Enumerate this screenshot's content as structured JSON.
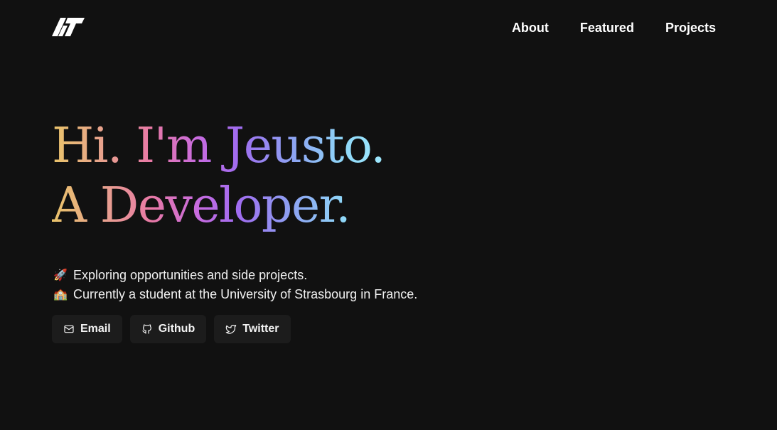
{
  "nav": {
    "logo_icon": "js-monogram-logo-icon",
    "links": [
      "About",
      "Featured",
      "Projects"
    ]
  },
  "hero": {
    "line1": "Hi. I'm Jeusto.",
    "line2": "A Developer.",
    "gradient_colors": [
      "#e9c46a",
      "#e879a6",
      "#a06cf0",
      "#8fd8f8"
    ]
  },
  "bio": {
    "items": [
      {
        "emoji": "🚀",
        "icon": "rocket-icon",
        "text": "Exploring opportunities and side projects."
      },
      {
        "emoji": "🏫",
        "icon": "school-icon",
        "text": "Currently a student at the University of Strasbourg in France."
      }
    ]
  },
  "socials": {
    "buttons": [
      {
        "label": "Email",
        "icon": "mail-icon"
      },
      {
        "label": "Github",
        "icon": "github-icon"
      },
      {
        "label": "Twitter",
        "icon": "twitter-icon"
      }
    ]
  },
  "colors": {
    "background": "#111111",
    "button_background": "#1c1c1c",
    "text": "#ffffff"
  }
}
